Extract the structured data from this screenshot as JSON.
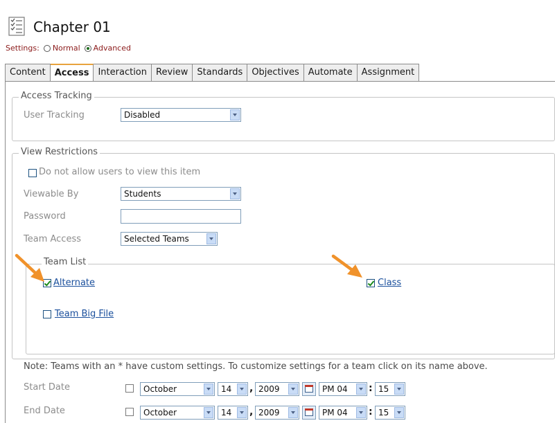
{
  "header": {
    "title": "Chapter 01",
    "settings_label": "Settings:",
    "mode_options": [
      {
        "label": "Normal",
        "selected": false
      },
      {
        "label": "Advanced",
        "selected": true
      }
    ]
  },
  "tabs": [
    {
      "label": "Content",
      "active": false
    },
    {
      "label": "Access",
      "active": true
    },
    {
      "label": "Interaction",
      "active": false
    },
    {
      "label": "Review",
      "active": false
    },
    {
      "label": "Standards",
      "active": false
    },
    {
      "label": "Objectives",
      "active": false
    },
    {
      "label": "Automate",
      "active": false
    },
    {
      "label": "Assignment",
      "active": false
    }
  ],
  "access_tracking": {
    "legend": "Access Tracking",
    "user_tracking_label": "User Tracking",
    "user_tracking_value": "Disabled"
  },
  "view_restrictions": {
    "legend": "View Restrictions",
    "do_not_allow_label": "Do not allow users to view this item",
    "do_not_allow_checked": false,
    "viewable_by_label": "Viewable By",
    "viewable_by_value": "Students",
    "password_label": "Password",
    "password_value": "",
    "team_access_label": "Team Access",
    "team_access_value": "Selected Teams"
  },
  "team_list": {
    "legend": "Team List",
    "teams": [
      {
        "label": "Alternate",
        "checked": true
      },
      {
        "label": "Class",
        "checked": true
      },
      {
        "label": "Team Big File",
        "checked": false
      }
    ]
  },
  "note": "Note: Teams with an * have custom settings. To customize settings for a team click on its name above.",
  "start_date": {
    "label": "Start Date",
    "enabled": false,
    "month": "October",
    "day": "14",
    "separator": ",",
    "year": "2009",
    "hour": "PM 04",
    "colon": ":",
    "minute": "15"
  },
  "end_date": {
    "label": "End Date",
    "enabled": false,
    "month": "October",
    "day": "14",
    "separator": ",",
    "year": "2009",
    "hour": "PM 04",
    "colon": ":",
    "minute": "15"
  },
  "colors": {
    "active_tab_accent": "#e8a33c",
    "annotation_arrow": "#f0922b",
    "link": "#1a4f9c",
    "settings_text": "#8b1a1a"
  }
}
